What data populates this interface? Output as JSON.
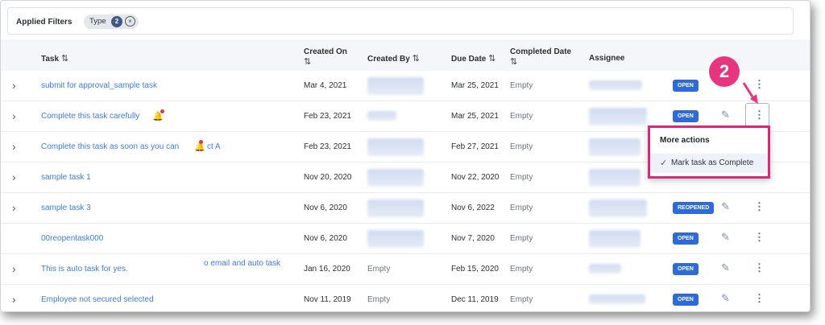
{
  "filters": {
    "label": "Applied Filters",
    "chip_label": "Type",
    "chip_count": "2",
    "chip_close": "×"
  },
  "columns": {
    "task": "Task",
    "created_on_line1": "Created On",
    "created_by": "Created By",
    "due_date": "Due Date",
    "completed_date": "Completed Date",
    "assignee": "Assignee",
    "sort_glyph": "⇅"
  },
  "rows": [
    {
      "task": "submit for approval_sample task",
      "created_on": "Mar 4, 2021",
      "created_by": "",
      "due_date": "Mar 25, 2021",
      "completed": "Empty",
      "status": "OPEN"
    },
    {
      "task": "Complete this task carefully",
      "created_on": "Feb 23, 2021",
      "created_by": "",
      "due_date": "Mar 25, 2021",
      "completed": "Empty",
      "status": "OPEN"
    },
    {
      "task": "Complete this task as soon as you can",
      "task_tail": "ct A",
      "created_on": "Feb 23, 2021",
      "created_by": "",
      "due_date": "Feb 27, 2021",
      "completed": "Empty",
      "status": ""
    },
    {
      "task": "sample task 1",
      "created_on": "Nov 20, 2020",
      "created_by": "",
      "due_date": "Nov 22, 2020",
      "completed": "Empty",
      "status": ""
    },
    {
      "task": "sample task 3",
      "created_on": "Nov 6, 2020",
      "created_by": "",
      "due_date": "Nov 6, 2022",
      "completed": "Empty",
      "status": "REOPENED"
    },
    {
      "task": "00reopentask000",
      "created_on": "Nov 6, 2020",
      "created_by": "",
      "due_date": "Nov 7, 2020",
      "completed": "Empty",
      "status": "OPEN"
    },
    {
      "task": "This is auto task for yes.",
      "task_tail": "o email and auto task",
      "created_on": "Jan 16, 2020",
      "created_by": "Empty",
      "due_date": "Feb 15, 2020",
      "completed": "Empty",
      "status": "OPEN"
    },
    {
      "task": "Employee not secured selected",
      "created_on": "Nov 11, 2019",
      "created_by": "Empty",
      "due_date": "Dec 11, 2019",
      "completed": "Empty",
      "status": "OPEN"
    }
  ],
  "annotation": {
    "step": "2"
  },
  "menu": {
    "title": "More actions",
    "item": "Mark task as Complete"
  },
  "icons": {
    "chevron": "›",
    "pencil": "✎",
    "kebab": "⋮",
    "check": "✓",
    "bell": "🔔"
  },
  "colors": {
    "accent": "#2f6bd8",
    "link": "#3d7be0",
    "highlight": "#d8297a",
    "callout": "#e8357f"
  }
}
